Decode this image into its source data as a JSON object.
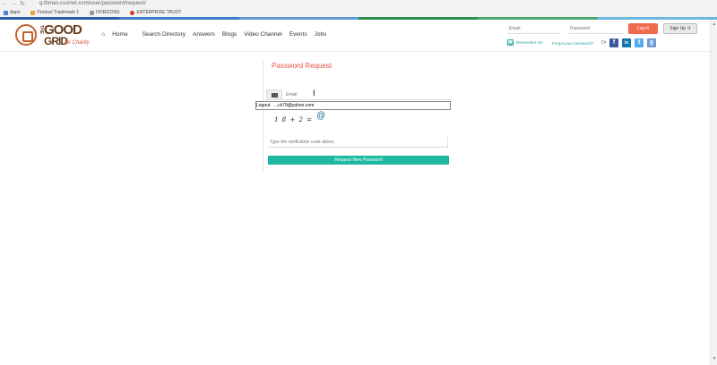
{
  "browser": {
    "url": "q.thmas.cssinet.com/user/password/request/",
    "bookmarks": [
      "Apps",
      "Product Trademark 1",
      "HORIZONS",
      "ENTERPRISE TRUST"
    ]
  },
  "strip_colors": [
    "#2e5ca8",
    "#3d7cc9",
    "#5e9ad6",
    "#2c8e51",
    "#4aa870",
    "#6db8e0"
  ],
  "logo": {
    "the": "THE",
    "good": "GOOD",
    "grid": "GRID",
    "tag": "for Charity"
  },
  "menu": [
    "Home",
    "Search Directory",
    "Answers",
    "Blogs",
    "Video Channel",
    "Events",
    "Jobs"
  ],
  "login": {
    "email_placeholder": "Email",
    "password_placeholder": "Password",
    "login_label": "Log in",
    "signup_label": "Sign Up",
    "remember_label": "Remember me",
    "forgot_label": "Forgot your password?",
    "or_label": "Or"
  },
  "social": [
    {
      "icon": "facebook-icon",
      "glyph": "f",
      "color": "#3b5998"
    },
    {
      "icon": "linkedin-icon",
      "glyph": "in",
      "color": "#0e76a8"
    },
    {
      "icon": "twitter-icon",
      "glyph": "t",
      "color": "#55acee"
    },
    {
      "icon": "google-icon",
      "glyph": "g",
      "color": "#6b9bd2"
    }
  ],
  "form": {
    "title": "Password Request",
    "email_placeholder": "Email",
    "autofill_label": "Logout",
    "autofill_value": "...ck79@yahoo.com",
    "captcha_text": "1 8 + 2 =",
    "verify_placeholder": "Type the verification code above",
    "submit_label": "Request New Password"
  }
}
